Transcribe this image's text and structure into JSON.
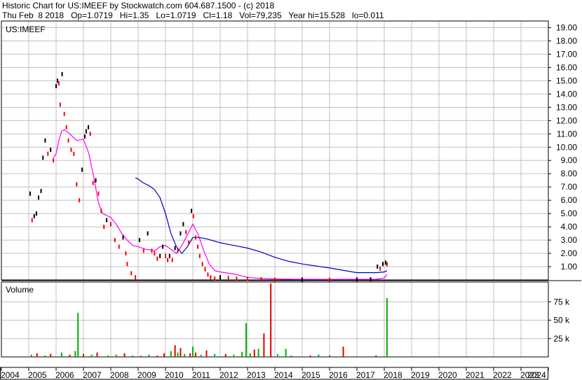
{
  "header": {
    "line1": "Historic Chart for US:IMEEF by Stockwatch.com 604.687.1500 - (c) 2018",
    "line2": "Thu Feb  8 2018   Op=1.0719   Hi=1.35   Lo=1.0719   Cl=1.18   Vol=79,235   Year hi=15.528   lo=0.011"
  },
  "colors": {
    "price": "#000000",
    "price_down": "#ff0000",
    "ma_short": "#ff00ff",
    "ma_long": "#0000c0",
    "vol_up": "#00b000",
    "vol_down": "#e00000",
    "grid": "#c0c0c0"
  },
  "chart_data": [
    {
      "type": "line",
      "panel": "price",
      "symbol_label": "US:IMEEF",
      "ylim": [
        0,
        19.5
      ],
      "y_ticks": [
        "1.00",
        "2.00",
        "3.00",
        "4.00",
        "5.00",
        "6.00",
        "7.00",
        "8.00",
        "9.00",
        "10.00",
        "11.00",
        "12.00",
        "13.00",
        "14.00",
        "15.00",
        "16.00",
        "17.00",
        "18.00",
        "19.00"
      ],
      "x_ticks": [
        "2004",
        "2005",
        "2006",
        "2007",
        "2008",
        "2009",
        "2010",
        "2011",
        "2012",
        "2013",
        "2014",
        "2015",
        "2016",
        "2017",
        "2018",
        "2019",
        "2020",
        "2021",
        "2022",
        "2023",
        "2024"
      ],
      "series": [
        {
          "role": "price",
          "x": [
            2005.05,
            2005.12,
            2005.2,
            2005.28,
            2005.36,
            2005.45,
            2005.52,
            2005.6,
            2005.7,
            2005.8,
            2005.9,
            2006.0,
            2006.05,
            2006.1,
            2006.15,
            2006.22,
            2006.3,
            2006.38,
            2006.45,
            2006.55,
            2006.65,
            2006.75,
            2006.85,
            2006.95,
            2007.05,
            2007.1,
            2007.18,
            2007.25,
            2007.35,
            2007.45,
            2007.55,
            2007.65,
            2007.75,
            2007.85,
            2008.0,
            2008.15,
            2008.3,
            2008.45,
            2008.55,
            2008.6,
            2008.75,
            2008.9,
            2009.05,
            2009.2,
            2009.35,
            2009.5,
            2009.6,
            2009.7,
            2009.8,
            2009.9,
            2010.0,
            2010.08,
            2010.15,
            2010.25,
            2010.35,
            2010.45,
            2010.55,
            2010.65,
            2010.75,
            2010.85,
            2010.95,
            2011.02,
            2011.1,
            2011.18,
            2011.25,
            2011.35,
            2011.45,
            2011.55,
            2011.65,
            2011.8,
            2012.0,
            2012.3,
            2012.6,
            2013.0,
            2013.5,
            2014.0,
            2015.0,
            2016.0,
            2017.0,
            2017.5,
            2017.75,
            2017.85,
            2017.95,
            2018.05,
            2018.1
          ],
          "values": [
            6.5,
            4.5,
            4.8,
            5.0,
            6.2,
            6.7,
            9.2,
            10.5,
            9.5,
            9.8,
            9.0,
            14.6,
            15.0,
            14.8,
            13.2,
            15.5,
            12.5,
            11.5,
            10.5,
            9.8,
            9.5,
            7.2,
            6.0,
            8.3,
            10.8,
            11.2,
            11.5,
            11.0,
            7.3,
            7.5,
            6.5,
            5.2,
            4.0,
            4.5,
            4.2,
            3.0,
            2.5,
            3.2,
            2.0,
            1.2,
            0.5,
            0.2,
            3.0,
            2.2,
            3.5,
            2.2,
            2.0,
            1.6,
            1.8,
            2.5,
            1.8,
            1.5,
            1.8,
            1.5,
            2.4,
            2.2,
            3.5,
            4.2,
            3.6,
            2.8,
            5.2,
            4.8,
            3.2,
            2.5,
            1.8,
            1.2,
            0.8,
            0.4,
            0.2,
            0.1,
            0.2,
            0.15,
            0.1,
            0.08,
            0.05,
            0.03,
            0.03,
            0.02,
            0.04,
            0.05,
            1.0,
            0.85,
            1.2,
            1.3,
            1.18
          ]
        },
        {
          "role": "ma_short",
          "x": [
            2005.9,
            2006.0,
            2006.1,
            2006.2,
            2006.3,
            2006.45,
            2006.6,
            2006.75,
            2007.0,
            2007.2,
            2007.4,
            2007.55,
            2007.7,
            2008.0,
            2008.2,
            2008.4,
            2008.6,
            2008.8,
            2009.0,
            2009.3,
            2009.6,
            2009.8,
            2010.0,
            2010.2,
            2010.4,
            2010.6,
            2010.8,
            2011.0,
            2011.2,
            2011.4,
            2011.6,
            2011.8,
            2012.0,
            2012.5,
            2013.0,
            2013.5,
            2014.0,
            2015.0,
            2016.0,
            2017.0,
            2017.7,
            2018.0,
            2018.1
          ],
          "values": [
            9.2,
            9.5,
            10.5,
            11.2,
            11.3,
            11.1,
            10.8,
            10.5,
            10.6,
            9.5,
            7.5,
            5.8,
            5.0,
            4.7,
            4.2,
            3.5,
            3.0,
            2.6,
            2.5,
            2.3,
            2.2,
            2.5,
            2.6,
            2.3,
            2.0,
            2.6,
            3.4,
            4.2,
            3.4,
            2.2,
            1.2,
            0.7,
            0.6,
            0.45,
            0.2,
            0.1,
            0.07,
            0.05,
            0.04,
            0.05,
            0.05,
            0.15,
            0.4
          ]
        },
        {
          "role": "ma_long",
          "x": [
            2008.9,
            2009.0,
            2009.2,
            2009.4,
            2009.6,
            2009.8,
            2010.0,
            2010.2,
            2010.4,
            2010.6,
            2010.8,
            2011.0,
            2011.2,
            2011.5,
            2012.0,
            2012.5,
            2013.0,
            2013.5,
            2014.0,
            2014.5,
            2015.0,
            2016.0,
            2017.0,
            2017.7,
            2018.0,
            2018.1
          ],
          "values": [
            7.7,
            7.6,
            7.3,
            7.1,
            6.8,
            6.2,
            5.0,
            3.5,
            2.5,
            2.0,
            2.5,
            3.2,
            3.2,
            3.1,
            2.8,
            2.6,
            2.4,
            2.1,
            1.7,
            1.4,
            1.2,
            0.9,
            0.55,
            0.55,
            0.6,
            0.7
          ]
        }
      ]
    },
    {
      "type": "bar",
      "panel": "volume",
      "title": "Volume",
      "ylim": [
        0,
        100000
      ],
      "y_ticks": [
        "25 k",
        "50 k",
        "75 k"
      ],
      "x": [
        2005.1,
        2005.3,
        2005.6,
        2005.8,
        2006.2,
        2006.5,
        2006.7,
        2006.8,
        2007.0,
        2007.3,
        2007.5,
        2007.9,
        2008.2,
        2008.5,
        2008.8,
        2009.1,
        2009.4,
        2009.7,
        2009.95,
        2010.2,
        2010.35,
        2010.45,
        2010.55,
        2010.7,
        2010.9,
        2011.0,
        2011.1,
        2011.3,
        2011.5,
        2011.8,
        2012.2,
        2012.5,
        2012.8,
        2012.95,
        2013.1,
        2013.25,
        2013.4,
        2013.6,
        2013.85,
        2014.1,
        2014.4,
        2014.6,
        2015.3,
        2015.6,
        2016.0,
        2016.5,
        2017.0,
        2017.6,
        2017.7,
        2018.1
      ],
      "values": [
        3000,
        5000,
        2000,
        4000,
        6000,
        3000,
        8000,
        60000,
        4000,
        3000,
        6000,
        2000,
        3000,
        5000,
        2000,
        1500,
        3000,
        2000,
        5000,
        8000,
        16000,
        6000,
        12000,
        4000,
        5000,
        14000,
        6000,
        3000,
        9000,
        4000,
        4000,
        3000,
        7000,
        46000,
        5000,
        10000,
        11000,
        32000,
        100000,
        4000,
        11000,
        2000,
        2000,
        3000,
        2000,
        14000,
        1000,
        1000,
        2000,
        80000
      ],
      "colors": [
        "g",
        "r",
        "g",
        "r",
        "g",
        "r",
        "g",
        "g",
        "r",
        "g",
        "r",
        "g",
        "g",
        "r",
        "g",
        "r",
        "g",
        "r",
        "r",
        "g",
        "r",
        "g",
        "r",
        "g",
        "r",
        "g",
        "r",
        "g",
        "r",
        "g",
        "r",
        "g",
        "g",
        "g",
        "g",
        "r",
        "g",
        "r",
        "r",
        "g",
        "g",
        "g",
        "r",
        "g",
        "r",
        "r",
        "g",
        "g",
        "r",
        "g"
      ]
    }
  ]
}
